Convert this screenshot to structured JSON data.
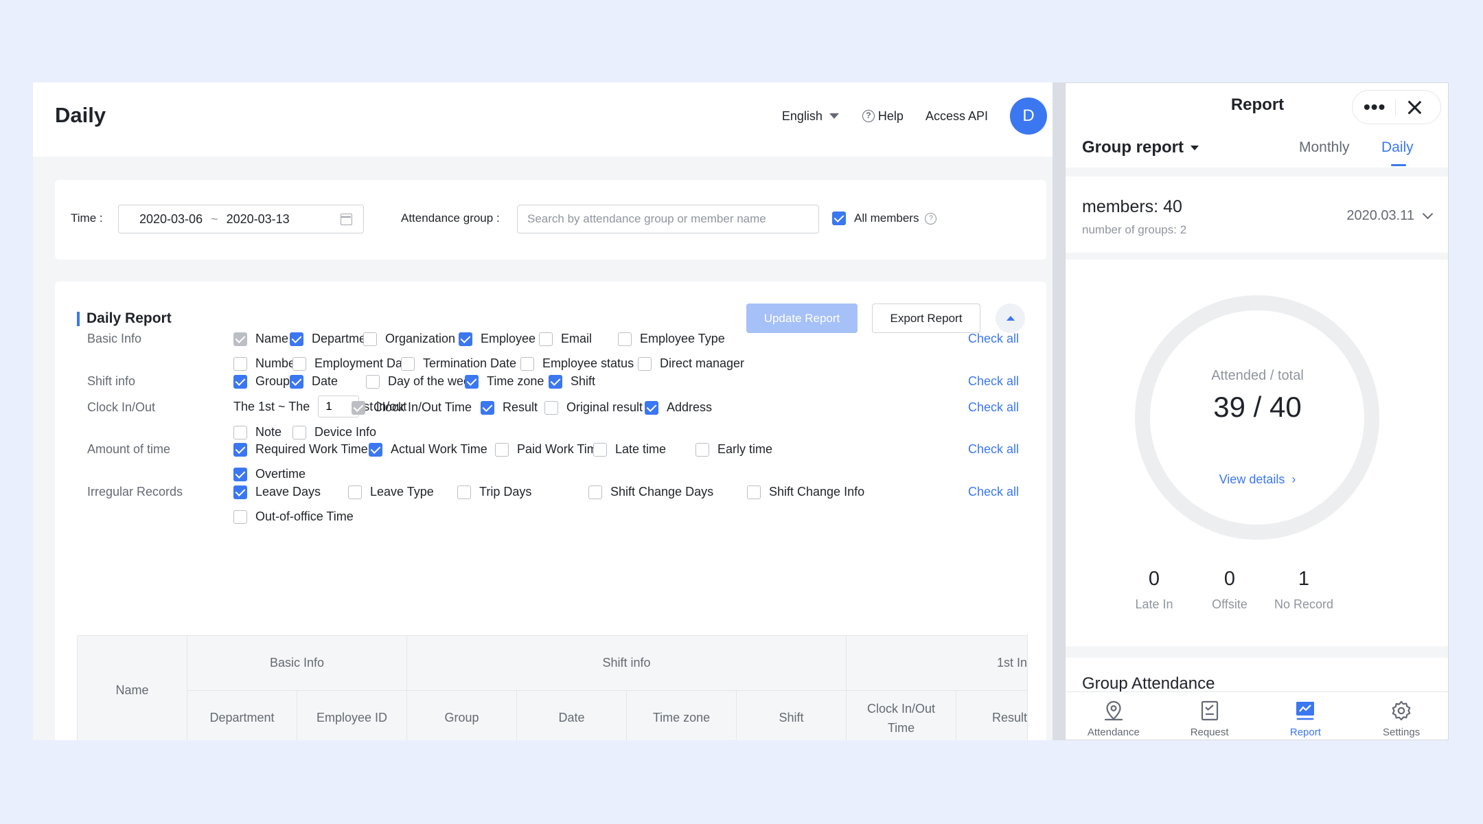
{
  "header": {
    "title": "Daily",
    "language": "English",
    "help": "Help",
    "access_api": "Access API",
    "avatar_initial": "D"
  },
  "filters": {
    "time_label": "Time :",
    "date_start": "2020-03-06",
    "date_sep": "~",
    "date_end": "2020-03-13",
    "group_label": "Attendance group :",
    "search_placeholder": "Search by attendance group or member name",
    "all_members": "All members"
  },
  "report": {
    "title": "Daily Report",
    "update_button": "Update Report",
    "export_button": "Export Report",
    "check_all": "Check all",
    "sections": [
      {
        "label": "Basic Info",
        "rows": [
          [
            {
              "text": "Name",
              "state": "disabled"
            },
            {
              "text": "Department",
              "state": "on"
            },
            {
              "text": "Organization",
              "state": "off"
            },
            {
              "text": "Employee ID",
              "state": "on"
            },
            {
              "text": "Email",
              "state": "off"
            },
            {
              "text": "Employee Type",
              "state": "off"
            }
          ],
          [
            {
              "text": "Number",
              "state": "off"
            },
            {
              "text": "Employment Date",
              "state": "off"
            },
            {
              "text": "Termination Date",
              "state": "off"
            },
            {
              "text": "Employee status",
              "state": "off"
            },
            {
              "text": "Direct manager",
              "state": "off"
            }
          ]
        ]
      },
      {
        "label": "Shift info",
        "rows": [
          [
            {
              "text": "Group",
              "state": "on"
            },
            {
              "text": "Date",
              "state": "on"
            },
            {
              "text": "Day of the week",
              "state": "off"
            },
            {
              "text": "Time zone",
              "state": "on"
            },
            {
              "text": "Shift",
              "state": "on"
            }
          ]
        ]
      },
      {
        "label": "Clock In/Out",
        "prefix": "The 1st ~ The",
        "input_value": "1",
        "suffix": "st in/out",
        "rows": [
          [
            {
              "text": "Clock In/Out Time",
              "state": "disabled"
            },
            {
              "text": "Result",
              "state": "on"
            },
            {
              "text": "Original result",
              "state": "off"
            },
            {
              "text": "Address",
              "state": "on"
            }
          ],
          [
            {
              "text": "Note",
              "state": "off"
            },
            {
              "text": "Device Info",
              "state": "off"
            }
          ]
        ]
      },
      {
        "label": "Amount of time",
        "rows": [
          [
            {
              "text": "Required Work Time",
              "state": "on"
            },
            {
              "text": "Actual Work Time",
              "state": "on"
            },
            {
              "text": "Paid Work Time",
              "state": "off"
            },
            {
              "text": "Late time",
              "state": "off"
            },
            {
              "text": "Early time",
              "state": "off"
            }
          ],
          [
            {
              "text": "Overtime",
              "state": "on"
            }
          ]
        ]
      },
      {
        "label": "Irregular Records",
        "rows": [
          [
            {
              "text": "Leave Days",
              "state": "on"
            },
            {
              "text": "Leave Type",
              "state": "off"
            },
            {
              "text": "Trip Days",
              "state": "off"
            },
            {
              "text": "Shift Change Days",
              "state": "off"
            },
            {
              "text": "Shift Change Info",
              "state": "off"
            }
          ],
          [
            {
              "text": "Out-of-office Time",
              "state": "off"
            }
          ]
        ]
      }
    ],
    "table": {
      "name_header": "Name",
      "groups": [
        "Basic Info",
        "Shift info",
        "1st In"
      ],
      "columns": [
        "Department",
        "Employee ID",
        "Group",
        "Date",
        "Time zone",
        "Shift",
        "Clock In/Out\nTime",
        "Result"
      ]
    }
  },
  "mobile": {
    "title": "Report",
    "group_report": "Group report",
    "tabs": [
      "Monthly",
      "Daily"
    ],
    "active_tab": "Daily",
    "members_label": "members: 40",
    "groups_label": "number of groups: 2",
    "date": "2020.03.11",
    "ring_label": "Attended / total",
    "attended": 39,
    "total": 40,
    "ring_value": "39 / 40",
    "view_details": "View details",
    "stats": [
      {
        "value": "0",
        "label": "Late In"
      },
      {
        "value": "0",
        "label": "Offsite"
      },
      {
        "value": "1",
        "label": "No Record"
      }
    ],
    "group_attendance": "Group Attendance",
    "nav": [
      {
        "label": "Attendance",
        "icon": "location-pin-icon"
      },
      {
        "label": "Request",
        "icon": "request-form-icon"
      },
      {
        "label": "Report",
        "icon": "report-chart-icon"
      },
      {
        "label": "Settings",
        "icon": "gear-icon"
      }
    ],
    "active_nav": "Report",
    "accent": "#3b77f1"
  }
}
